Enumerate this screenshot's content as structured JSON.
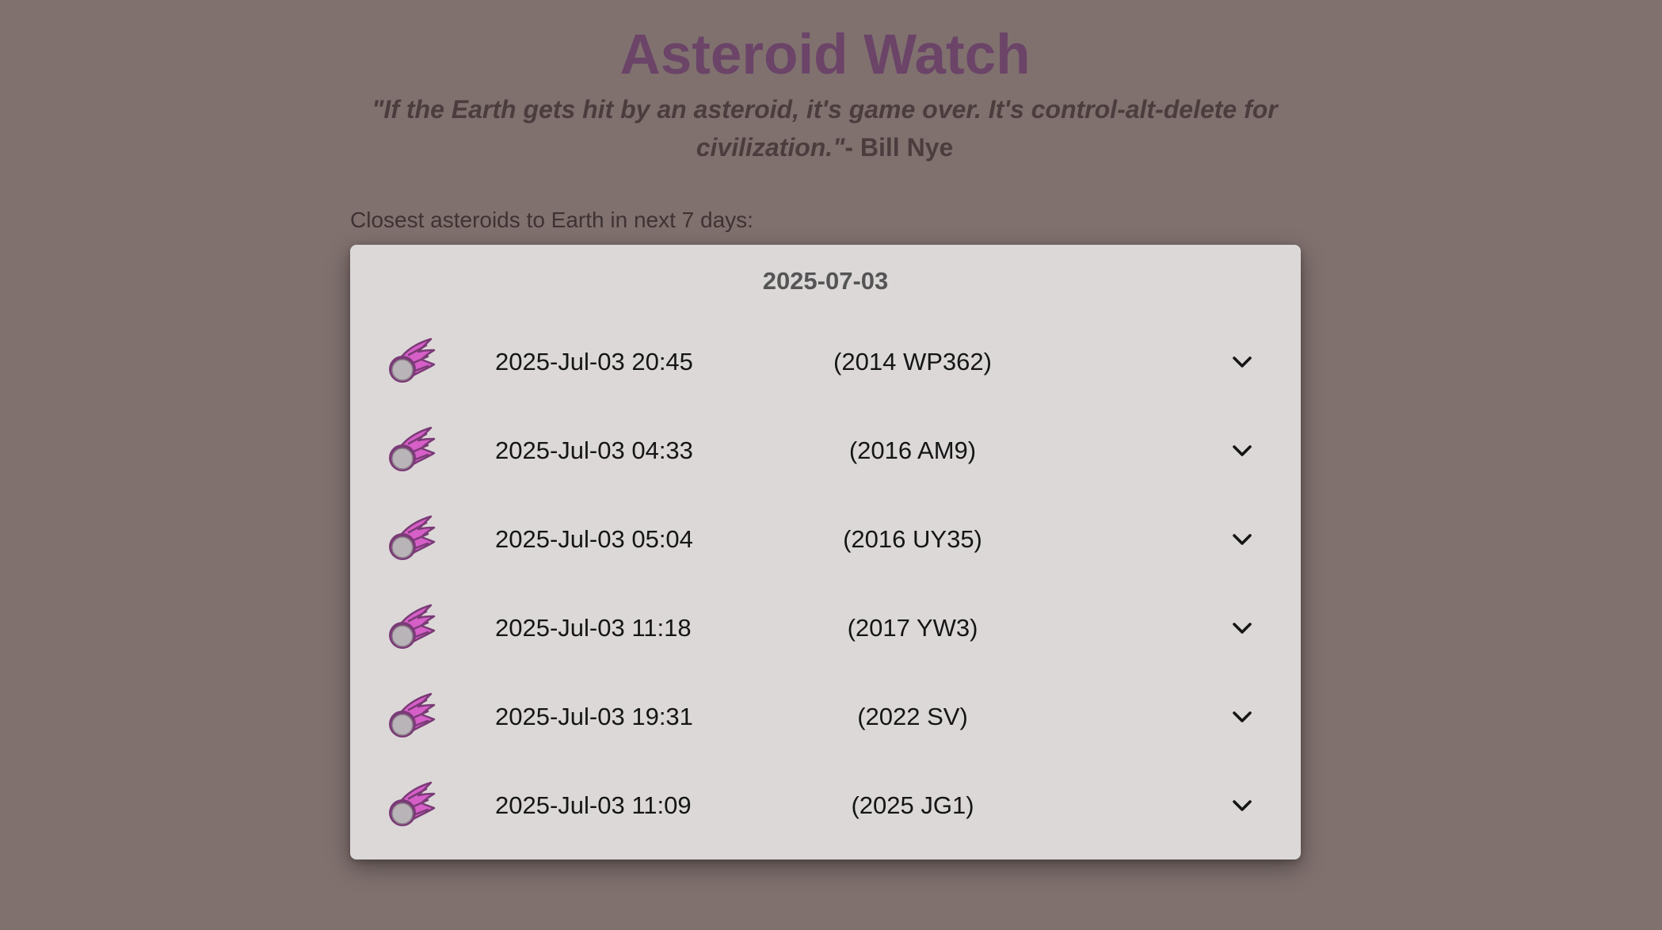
{
  "header": {
    "title": "Asteroid Watch",
    "quote_text": "\"If the Earth gets hit by an asteroid, it's game over. It's control-alt-delete for civilization.\"",
    "quote_author": "- Bill Nye"
  },
  "intro": "Closest asteroids to Earth in next 7 days:",
  "card": {
    "date": "2025-07-03",
    "rows": [
      {
        "time": "2025-Jul-03 20:45",
        "name": "(2014 WP362)",
        "icon": "asteroid-icon",
        "toggle_icon": "chevron-down-icon"
      },
      {
        "time": "2025-Jul-03 04:33",
        "name": "(2016 AM9)",
        "icon": "asteroid-icon",
        "toggle_icon": "chevron-down-icon"
      },
      {
        "time": "2025-Jul-03 05:04",
        "name": "(2016 UY35)",
        "icon": "asteroid-icon",
        "toggle_icon": "chevron-down-icon"
      },
      {
        "time": "2025-Jul-03 11:18",
        "name": "(2017 YW3)",
        "icon": "asteroid-icon",
        "toggle_icon": "chevron-down-icon"
      },
      {
        "time": "2025-Jul-03 19:31",
        "name": "(2022 SV)",
        "icon": "asteroid-icon",
        "toggle_icon": "chevron-down-icon"
      },
      {
        "time": "2025-Jul-03 11:09",
        "name": "(2025 JG1)",
        "icon": "asteroid-icon",
        "toggle_icon": "chevron-down-icon"
      }
    ]
  },
  "colors": {
    "background": "#80716f",
    "title": "#6b4468",
    "card": "#dcd8d8",
    "asteroid_tail": "#d65fc8",
    "asteroid_body": "#b9b4b8"
  }
}
